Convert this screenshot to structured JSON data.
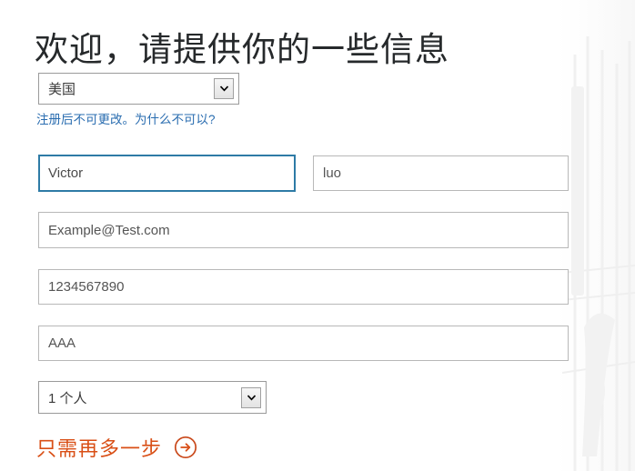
{
  "page": {
    "title": "欢迎，请提供你的一些信息",
    "background_color": "#ffffff"
  },
  "form": {
    "country": {
      "label_name": "country-select",
      "selected_value": "美国",
      "chevron_icon": "chevron-down-icon",
      "note_text": "注册后不可更改。为什么不可以?",
      "note_color": "#2a6db0"
    },
    "first_name": {
      "value": "Victor",
      "placeholder": "Victor",
      "focused": true,
      "focus_border_color": "#2e7ba6"
    },
    "last_name": {
      "value": "luo",
      "placeholder": "luo",
      "focused": false
    },
    "email": {
      "value": "Example@Test.com",
      "placeholder": "Example@Test.com",
      "focused": false
    },
    "phone": {
      "value": "1234567890",
      "placeholder": "1234567890",
      "focused": false
    },
    "company": {
      "value": "AAA",
      "placeholder": "AAA",
      "focused": false
    },
    "company_size": {
      "selected_value": "1 个人",
      "chevron_icon": "chevron-down-icon"
    }
  },
  "cta": {
    "label": "只需再多一步",
    "arrow_icon": "circled-arrow-right-icon",
    "color": "#d94f16"
  },
  "decor": {
    "background_art_name": "faint-building-photo"
  }
}
